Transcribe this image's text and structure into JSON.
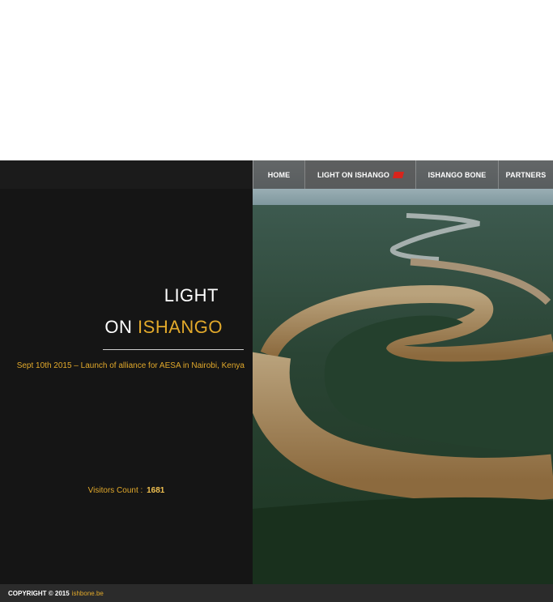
{
  "nav": {
    "items": [
      {
        "label": "HOME"
      },
      {
        "label": "LIGHT ON ISHANGO"
      },
      {
        "label": "ISHANGO BONE"
      },
      {
        "label": "PARTNERS"
      }
    ]
  },
  "hero": {
    "title_line1": "LIGHT",
    "title_line2_prefix": "ON ",
    "title_line2_accent": "ISHANGO",
    "news": "Sept 10th 2015 – Launch of alliance for AESA in Nairobi, Kenya"
  },
  "visitors": {
    "label": "Visitors Count :",
    "count": "1681"
  },
  "footer": {
    "copyright": "COPYRIGHT © 2015",
    "site": "ishbone.be"
  },
  "colors": {
    "accent": "#e2a92b",
    "panel": "#151515",
    "footer": "#2b2b2b",
    "flag": "#d8241c"
  }
}
